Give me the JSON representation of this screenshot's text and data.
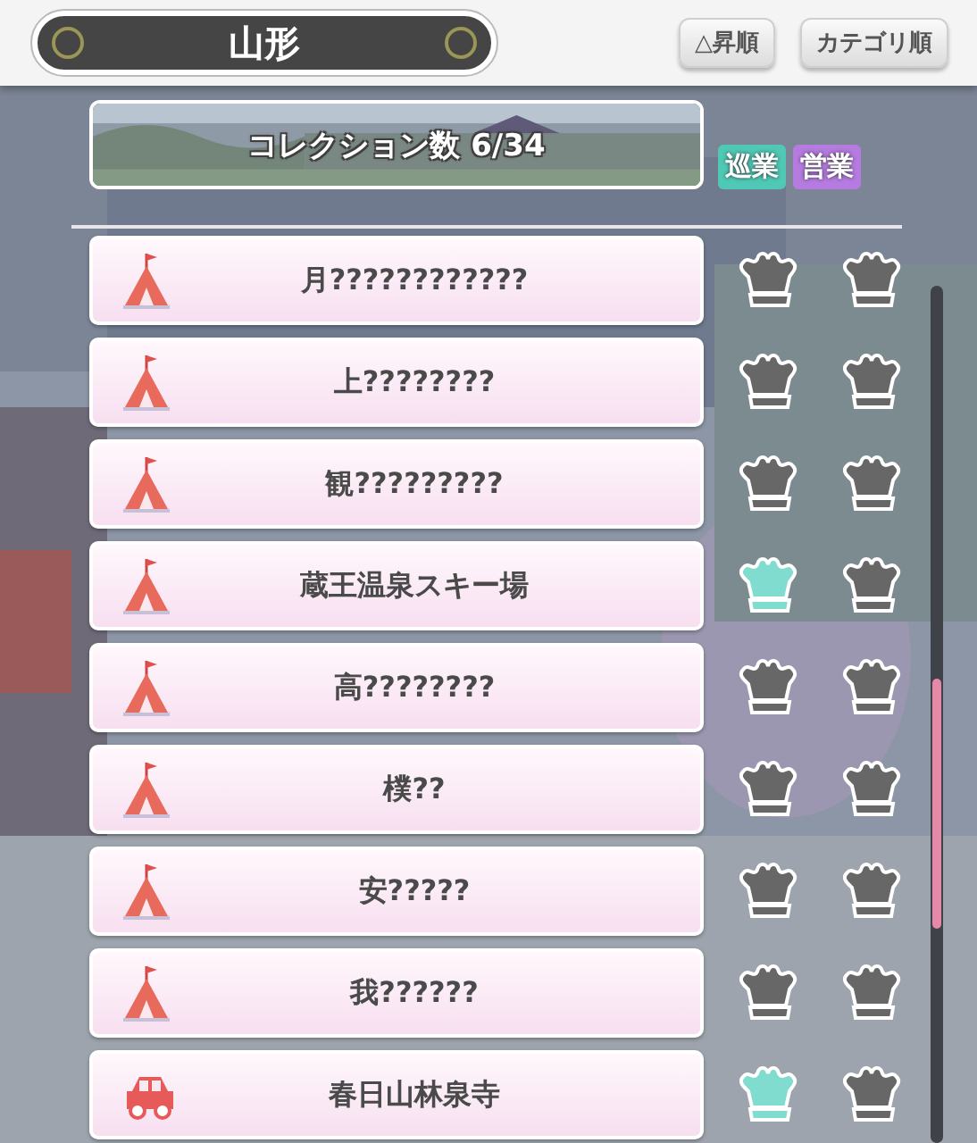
{
  "header": {
    "title": "山形",
    "buttons": [
      "△昇順",
      "カテゴリ順"
    ]
  },
  "banner": {
    "label": "コレクション数 6/34"
  },
  "tags": [
    {
      "label": "巡業",
      "color": "#4fc9b5"
    },
    {
      "label": "営業",
      "color": "#b57be0"
    }
  ],
  "rows": [
    {
      "kind": "tent",
      "name": "月????????????",
      "crowns": [
        {
          "earned": false
        },
        {
          "earned": false
        }
      ]
    },
    {
      "kind": "tent",
      "name": "上????????",
      "crowns": [
        {
          "earned": false
        },
        {
          "earned": false
        }
      ]
    },
    {
      "kind": "tent",
      "name": "観?????????",
      "crowns": [
        {
          "earned": false
        },
        {
          "earned": false
        }
      ]
    },
    {
      "kind": "tent",
      "name": "蔵王温泉スキー場",
      "crowns": [
        {
          "earned": true
        },
        {
          "earned": false
        }
      ]
    },
    {
      "kind": "tent",
      "name": "高????????",
      "crowns": [
        {
          "earned": false
        },
        {
          "earned": false
        }
      ]
    },
    {
      "kind": "tent",
      "name": "樸??",
      "crowns": [
        {
          "earned": false
        },
        {
          "earned": false
        }
      ]
    },
    {
      "kind": "tent",
      "name": "安?????",
      "crowns": [
        {
          "earned": false
        },
        {
          "earned": false
        }
      ]
    },
    {
      "kind": "tent",
      "name": "我??????",
      "crowns": [
        {
          "earned": false
        },
        {
          "earned": false
        }
      ]
    },
    {
      "kind": "car",
      "name": "春日山林泉寺",
      "crowns": [
        {
          "earned": true
        },
        {
          "earned": false
        }
      ]
    }
  ]
}
